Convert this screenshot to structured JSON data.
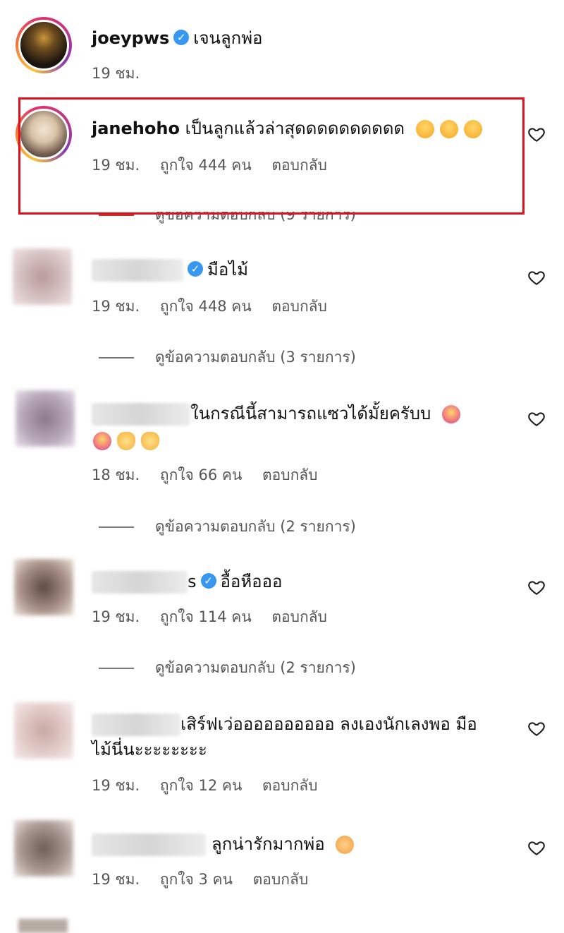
{
  "comments": [
    {
      "username": "joeypws",
      "verified": true,
      "text": "เจนลูกพ่อ",
      "time": "19 ชม.",
      "likes": "",
      "reply": "",
      "view_replies": ""
    },
    {
      "username": "janehoho",
      "verified": false,
      "text": "เป็นลูกแล้วล่าสุดดดดดดดดดด",
      "time": "19 ชม.",
      "likes": "ถูกใจ 444 คน",
      "reply": "ตอบกลับ",
      "view_replies": "ดูข้อความตอบกลับ (9 รายการ)"
    },
    {
      "username": "",
      "verified": true,
      "text": "มือไม้",
      "time": "19 ชม.",
      "likes": "ถูกใจ 448 คน",
      "reply": "ตอบกลับ",
      "view_replies": "ดูข้อความตอบกลับ (3 รายการ)"
    },
    {
      "username": "",
      "verified": false,
      "text": "ในกรณีนี้สามารถแซวได้มั้ยครับบ",
      "time": "18 ชม.",
      "likes": "ถูกใจ 66 คน",
      "reply": "ตอบกลับ",
      "view_replies": "ดูข้อความตอบกลับ (2 รายการ)"
    },
    {
      "username": "s",
      "verified": true,
      "text": "อื้อหือออ",
      "time": "19 ชม.",
      "likes": "ถูกใจ 114 คน",
      "reply": "ตอบกลับ",
      "view_replies": "ดูข้อความตอบกลับ (2 รายการ)"
    },
    {
      "username": "",
      "verified": false,
      "text": "เสิร์ฟเว่ออออออออออ ลงเองนักเลงพอ มือ",
      "text2": "ไม้นี่นะะะะะะะะ",
      "time": "19 ชม.",
      "likes": "ถูกใจ 12 คน",
      "reply": "ตอบกลับ",
      "view_replies": ""
    },
    {
      "username": "",
      "verified": false,
      "text": "ลูกน่ารักมากพ่อ",
      "time": "19 ชม.",
      "likes": "ถูกใจ 3 คน",
      "reply": "ตอบกลับ",
      "view_replies": ""
    }
  ],
  "icons": {
    "verified": "verified-badge-icon",
    "like": "heart-outline-icon"
  },
  "colors": {
    "highlight": "#e0101a",
    "verified": "#3897f0",
    "meta": "#555555"
  }
}
